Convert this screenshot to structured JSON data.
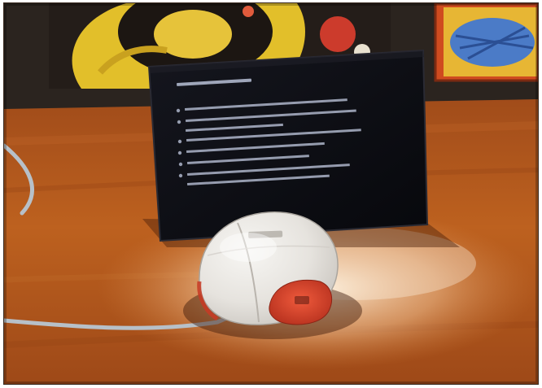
{
  "image": {
    "kind": "photograph",
    "colors": {
      "desk_wood": "#b65a1d",
      "wall_dark": "#2a2420",
      "poster_yellow": "#e2bf2a",
      "screen_black": "#0b0c12",
      "screen_text": "#cfd8f0",
      "mouse_body": "#e9e7e2",
      "mouse_accent": "#d7432b",
      "cable_gray": "#b7c0c8"
    }
  }
}
